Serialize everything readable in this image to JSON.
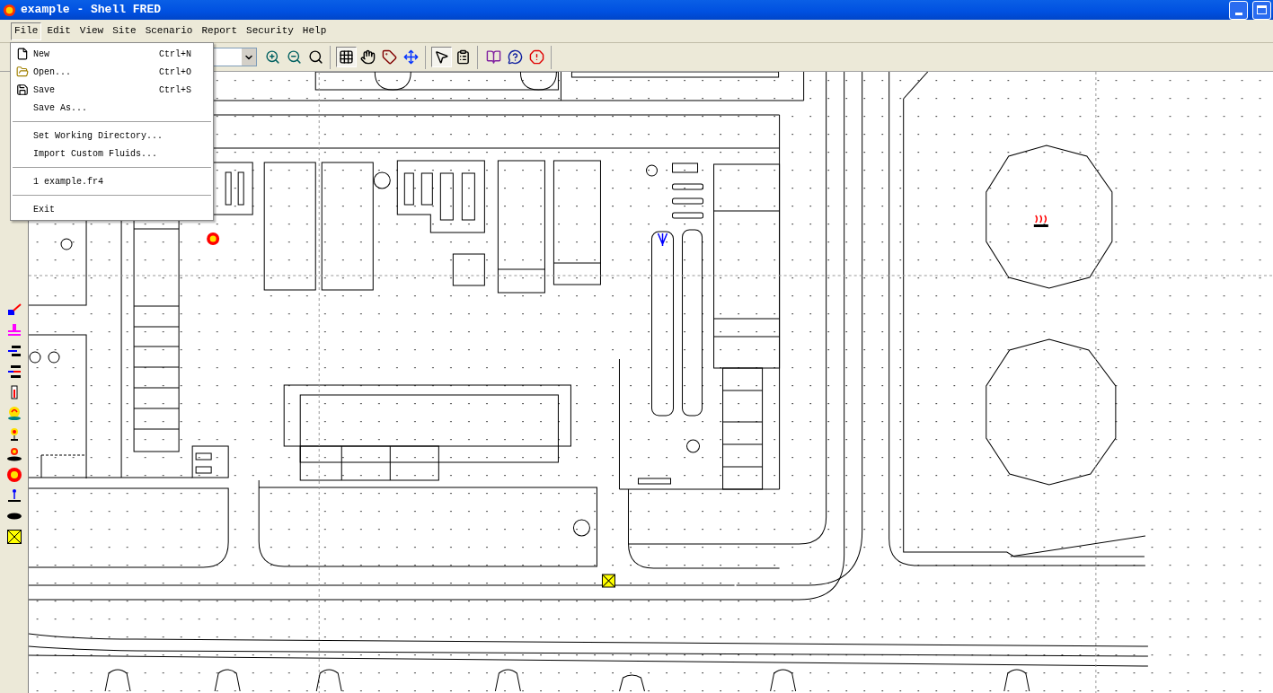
{
  "window": {
    "title": "example - Shell FRED"
  },
  "menu_bar": [
    {
      "label": "File",
      "selected": true
    },
    {
      "label": "Edit",
      "selected": false
    },
    {
      "label": "View",
      "selected": false
    },
    {
      "label": "Site",
      "selected": false
    },
    {
      "label": "Scenario",
      "selected": false
    },
    {
      "label": "Report",
      "selected": false
    },
    {
      "label": "Security",
      "selected": false
    },
    {
      "label": "Help",
      "selected": false
    }
  ],
  "file_menu": [
    {
      "kind": "new",
      "label": "New",
      "shortcut": "Ctrl+N"
    },
    {
      "kind": "open",
      "label": "Open...",
      "shortcut": "Ctrl+O"
    },
    {
      "kind": "save",
      "label": "Save",
      "shortcut": "Ctrl+S"
    },
    {
      "kind": "item",
      "label": "Save As..."
    },
    {
      "kind": "separator"
    },
    {
      "kind": "item",
      "label": "Set Working Directory..."
    },
    {
      "kind": "item",
      "label": "Import Custom Fluids..."
    },
    {
      "kind": "separator"
    },
    {
      "kind": "item",
      "label": "1 example.fr4"
    },
    {
      "kind": "separator"
    },
    {
      "kind": "item",
      "label": "Exit"
    }
  ],
  "toolbar": [
    [
      {
        "kind": "zoom-in",
        "selected": false
      },
      {
        "kind": "zoom-out",
        "selected": false
      },
      {
        "kind": "zoom",
        "selected": false
      }
    ],
    [
      {
        "kind": "grid",
        "selected": true
      },
      {
        "kind": "pan",
        "selected": false
      },
      {
        "kind": "label",
        "selected": false
      },
      {
        "kind": "fit",
        "selected": false
      }
    ],
    [
      {
        "kind": "pointer",
        "selected": true
      },
      {
        "kind": "properties",
        "selected": false
      }
    ],
    [
      {
        "kind": "book",
        "selected": false
      },
      {
        "kind": "help",
        "selected": false
      },
      {
        "kind": "alert",
        "selected": false
      }
    ]
  ]
}
